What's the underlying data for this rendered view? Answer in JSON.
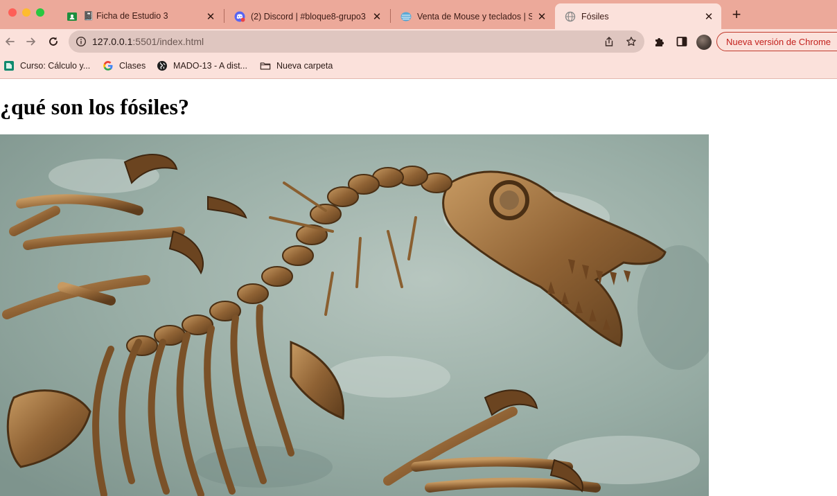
{
  "tabs": [
    {
      "title": "📓 Ficha de Estudio 3",
      "favicon": "google-classroom-icon",
      "active": false
    },
    {
      "title": "(2) Discord | #bloque8-grupo3",
      "favicon": "discord-icon",
      "active": false
    },
    {
      "title": "Venta de Mouse y teclados | St",
      "favicon": "store-icon",
      "active": false
    },
    {
      "title": "Fósiles",
      "favicon": "globe-icon",
      "active": true
    }
  ],
  "toolbar": {
    "url_host": "127.0.0.1",
    "url_rest": ":5501/index.html",
    "update_label": "Nueva versión de Chrome"
  },
  "bookmarks": [
    {
      "label": "Curso: Cálculo y...",
      "icon": "classroom-icon"
    },
    {
      "label": "Clases",
      "icon": "google-icon"
    },
    {
      "label": "MADO-13 - A dist...",
      "icon": "world-icon"
    },
    {
      "label": "Nueva carpeta",
      "icon": "folder-icon"
    }
  ],
  "page": {
    "heading": "¿qué son los fósiles?"
  },
  "colors": {
    "tabstrip": "#eca99a",
    "toolbar": "#fbe1db",
    "omnibox": "#dfc6c0",
    "update_accent": "#c3211d"
  }
}
